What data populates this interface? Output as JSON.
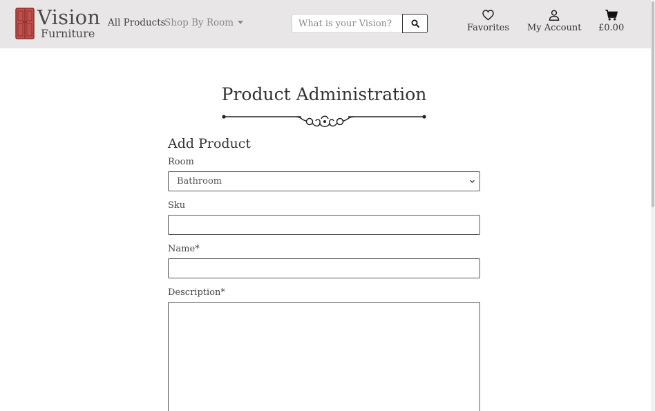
{
  "brand": {
    "title": "Vision",
    "subtitle": "Furniture",
    "accent": "#c0504d"
  },
  "nav": {
    "all_products": "All Products",
    "shop_by_room": "Shop By Room",
    "search_placeholder": "What is your Vision?",
    "favorites": "Favorites",
    "my_account": "My Account",
    "cart_total": "£0.00"
  },
  "page": {
    "title": "Product Administration"
  },
  "form": {
    "heading": "Add Product",
    "room_label": "Room",
    "room_selected": "Bathroom",
    "sku_label": "Sku",
    "sku_value": "",
    "name_label": "Name*",
    "name_value": "",
    "description_label": "Description*",
    "description_value": ""
  },
  "icons": [
    "wardrobe-logo-icon",
    "chevron-down-icon",
    "search-icon",
    "heart-icon",
    "user-icon",
    "cart-icon",
    "ornament-divider-icon"
  ]
}
